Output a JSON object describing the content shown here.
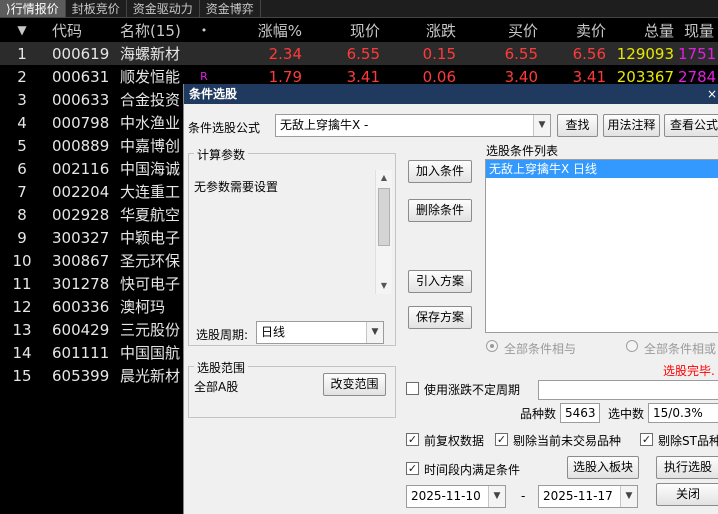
{
  "tabs": [
    "行情报价",
    "封板竞价",
    "资金驱动力",
    "资金博弈"
  ],
  "table": {
    "columns": {
      "code": "代码",
      "name": "名称(15)",
      "dot": "•",
      "change_pct": "涨幅%",
      "price": "现价",
      "change": "涨跌",
      "bid": "买价",
      "ask": "卖价",
      "volume": "总量",
      "current": "现量"
    },
    "rows": [
      {
        "idx": "1",
        "code": "000619",
        "name": "海螺新材",
        "flag": "",
        "change_pct": "2.34",
        "price": "6.55",
        "change": "0.15",
        "bid": "6.55",
        "ask": "6.56",
        "volume": "129093",
        "current": "1751"
      },
      {
        "idx": "2",
        "code": "000631",
        "name": "顺发恒能",
        "flag": "R",
        "change_pct": "1.79",
        "price": "3.41",
        "change": "0.06",
        "bid": "3.40",
        "ask": "3.41",
        "volume": "203367",
        "current": "2784"
      },
      {
        "idx": "3",
        "code": "000633",
        "name": "合金投资"
      },
      {
        "idx": "4",
        "code": "000798",
        "name": "中水渔业"
      },
      {
        "idx": "5",
        "code": "000889",
        "name": "中嘉博创"
      },
      {
        "idx": "6",
        "code": "002116",
        "name": "中国海诚"
      },
      {
        "idx": "7",
        "code": "002204",
        "name": "大连重工"
      },
      {
        "idx": "8",
        "code": "002928",
        "name": "华夏航空"
      },
      {
        "idx": "9",
        "code": "300327",
        "name": "中颖电子"
      },
      {
        "idx": "10",
        "code": "300867",
        "name": "圣元环保"
      },
      {
        "idx": "11",
        "code": "301278",
        "name": "快可电子"
      },
      {
        "idx": "12",
        "code": "600336",
        "name": "澳柯玛"
      },
      {
        "idx": "13",
        "code": "600429",
        "name": "三元股份"
      },
      {
        "idx": "14",
        "code": "601111",
        "name": "中国国航"
      },
      {
        "idx": "15",
        "code": "605399",
        "name": "晨光新材"
      }
    ]
  },
  "dialog": {
    "title": "条件选股",
    "close": "×",
    "formula_label": "条件选股公式",
    "formula_value": "无敌上穿擒牛X  -",
    "search_btn": "查找",
    "usage_btn": "用法注释",
    "view_formula_btn": "查看公式",
    "params_label": "计算参数",
    "params_text": "无参数需要设置",
    "period_label": "选股周期:",
    "period_value": "日线",
    "add_btn": "加入条件",
    "delete_btn": "删除条件",
    "import_btn": "引入方案",
    "save_btn": "保存方案",
    "list_label": "选股条件列表",
    "list_items": [
      "无敌上穿擒牛X  日线"
    ],
    "radio_and": "全部条件相与",
    "radio_or": "全部条件相或",
    "status": "选股完毕.",
    "range_label": "选股范围",
    "range_value": "全部A股",
    "change_range_btn": "改变范围",
    "use_period_label": "使用涨跌不定周期",
    "count_label": "品种数",
    "count_value": "5463",
    "selected_label": "选中数",
    "selected_value": "15/0.3%",
    "prev_adj_label": "前复权数据",
    "exclude_untraded_label": "剔除当前未交易品种",
    "exclude_st_label": "剔除ST品种",
    "time_range_label": "时间段内满足条件",
    "add_block_btn": "选股入板块",
    "run_btn": "执行选股",
    "date_start": "2025-11-10",
    "date_sep": "-",
    "date_end": "2025-11-17",
    "close_btn": "关闭"
  },
  "colors": {
    "up": "#ff3a3a",
    "volume": "#e8e800",
    "current_volume": "#e020e0",
    "dialog_title_bg": "#1f3a5e",
    "selection": "#3399ff",
    "status_text": "#ff0000"
  }
}
